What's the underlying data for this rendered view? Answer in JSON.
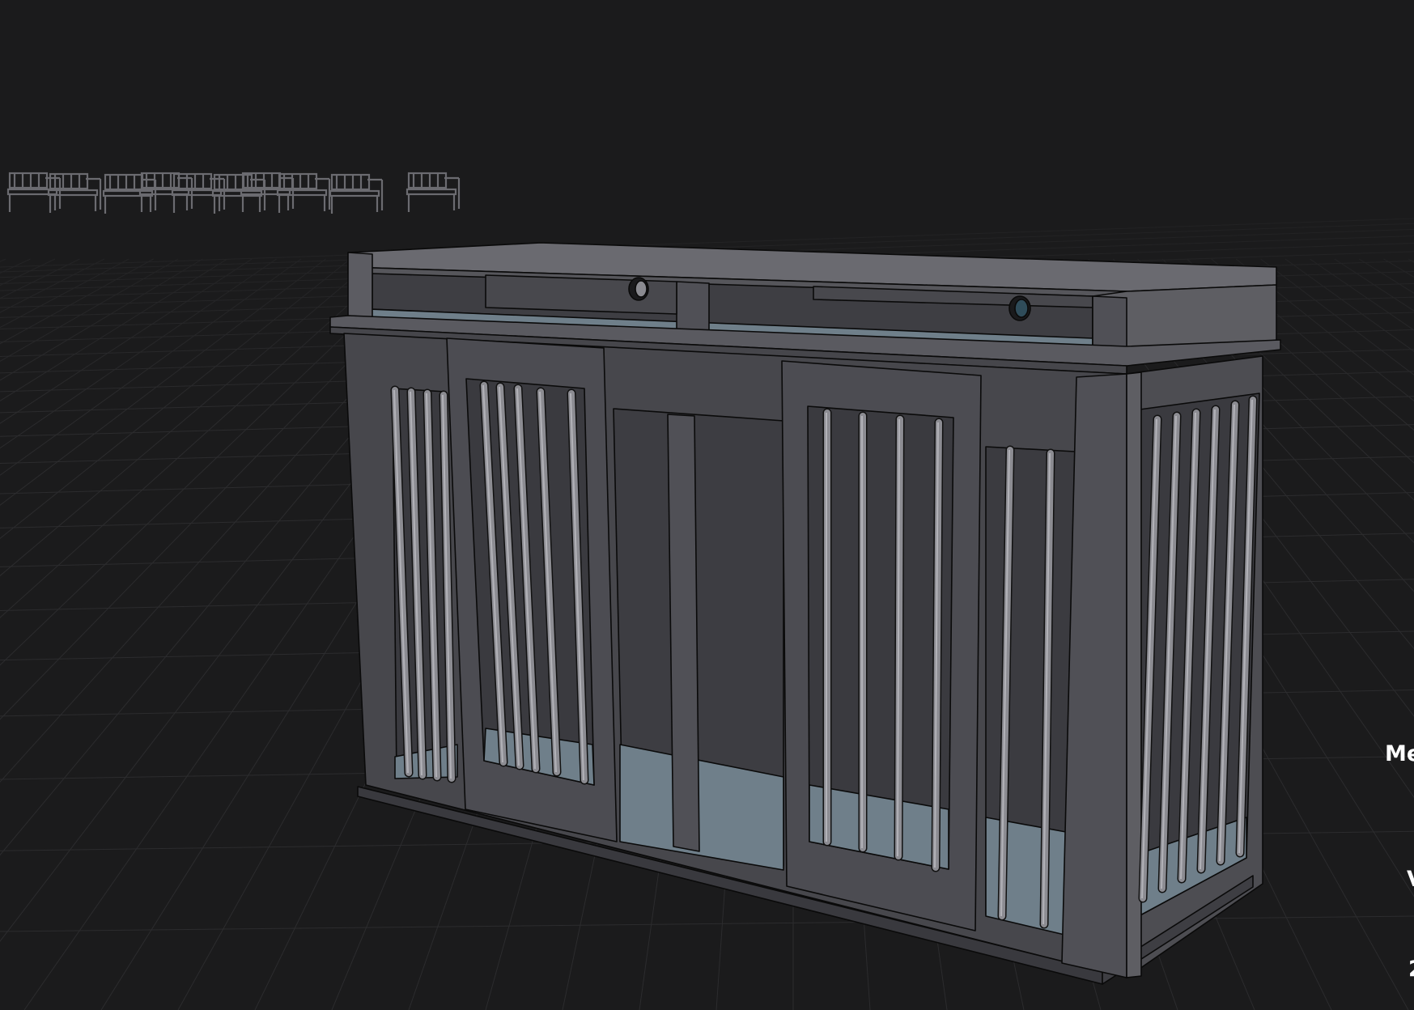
{
  "viewport": {
    "background": "#1b1b1c",
    "grid_color": "#2c2c2e",
    "model_fill": "#4a4a4f",
    "model_top_fill": "#5e5e63",
    "interior_floor_color": "#6f7f8a",
    "bar_color": "#8a8a8f",
    "outline_color": "#0a0a0a"
  },
  "side_panel": {
    "labels": [
      "Me",
      "V",
      "2"
    ]
  },
  "icons": {
    "cable_grommet_left": "circle-icon",
    "cable_grommet_right": "circle-icon"
  }
}
